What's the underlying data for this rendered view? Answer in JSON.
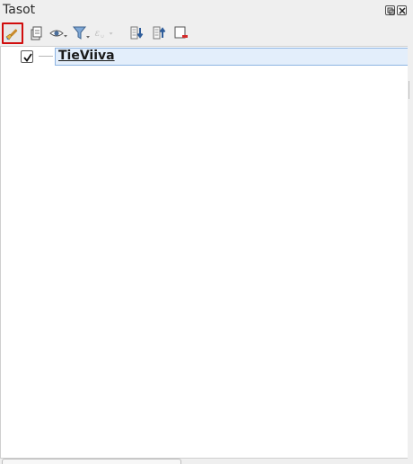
{
  "panel": {
    "title": "Tasot"
  },
  "toolbar": {
    "buttons": [
      {
        "icon": "paintbrush-style-icon",
        "name": "style-manager-button",
        "active": true
      },
      {
        "icon": "add-group-icon",
        "name": "add-group-button"
      },
      {
        "icon": "eye-visibility-icon",
        "name": "manage-visibility-button"
      },
      {
        "icon": "filter-funnel-icon",
        "name": "filter-legend-button"
      },
      {
        "icon": "expression-filter-icon",
        "name": "filter-by-expression-button",
        "disabled": true
      },
      {
        "icon": "expand-all-icon",
        "name": "expand-all-button"
      },
      {
        "icon": "collapse-all-icon",
        "name": "collapse-all-button"
      },
      {
        "icon": "remove-layer-icon",
        "name": "remove-layer-button"
      }
    ]
  },
  "layers": [
    {
      "name": "TieViiva",
      "checked": true,
      "selected": true
    }
  ],
  "colors": {
    "active_border": "#d10d0d",
    "selection_bg": "#e3eefb",
    "selection_border": "#8db4e2"
  }
}
